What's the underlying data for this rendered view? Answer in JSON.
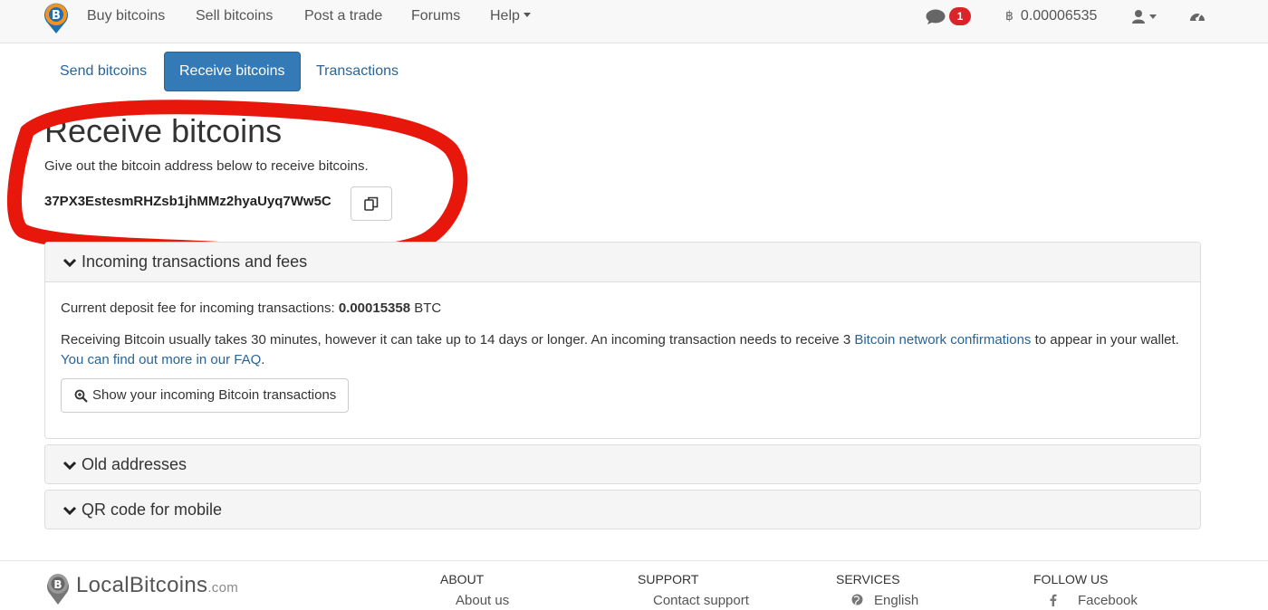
{
  "navbar": {
    "links": [
      "Buy bitcoins",
      "Sell bitcoins",
      "Post a trade",
      "Forums",
      "Help"
    ],
    "message_count": "1",
    "balance": "0.00006535",
    "balance_icon": "bitcoin-icon",
    "icons": [
      "logo-pin-icon",
      "chat-bubble-icon",
      "user-icon",
      "dashboard-icon"
    ]
  },
  "tabs": {
    "items": [
      "Send bitcoins",
      "Receive bitcoins",
      "Transactions"
    ],
    "active": "Receive bitcoins"
  },
  "receive": {
    "title": "Receive bitcoins",
    "intro": "Give out the bitcoin address below to receive bitcoins.",
    "address": "37PX3EstesmRHZsb1jhMMz2hyaUyq7Ww5C",
    "copy_icon": "copy-icon",
    "annotation_color": "#e8170b"
  },
  "panels": {
    "incoming": {
      "title": "Incoming transactions and fees",
      "fee_label": "Current deposit fee for incoming transactions: ",
      "fee_value": "0.00015358",
      "fee_unit": " BTC",
      "info_part1": "Receiving Bitcoin usually takes 30 minutes, however it can take up to 14 days or longer. An incoming transaction needs to receive 3 ",
      "info_link1": "Bitcoin network confirmations",
      "info_part2": " to appear in your wallet. ",
      "info_link2": "You can find out more in our FAQ",
      "info_end": ".",
      "show_button": "Show your incoming Bitcoin transactions"
    },
    "old_addresses": {
      "title": "Old addresses"
    },
    "qr": {
      "title": "QR code for mobile"
    }
  },
  "footer": {
    "logo_text": "LocalBitcoins",
    "logo_suffix": ".com",
    "columns": [
      {
        "heading": "ABOUT",
        "link": "About us"
      },
      {
        "heading": "SUPPORT",
        "link": "Contact support"
      },
      {
        "heading": "SERVICES",
        "link": "English",
        "icon": "globe-icon"
      },
      {
        "heading": "FOLLOW US",
        "link": "Facebook",
        "icon": "facebook-icon"
      }
    ]
  },
  "colors": {
    "link": "#2a6496",
    "active_tab": "#337ab7",
    "badge": "#d9242a",
    "brand_orange": "#f7931a",
    "brand_blue": "#1f6fb5"
  }
}
